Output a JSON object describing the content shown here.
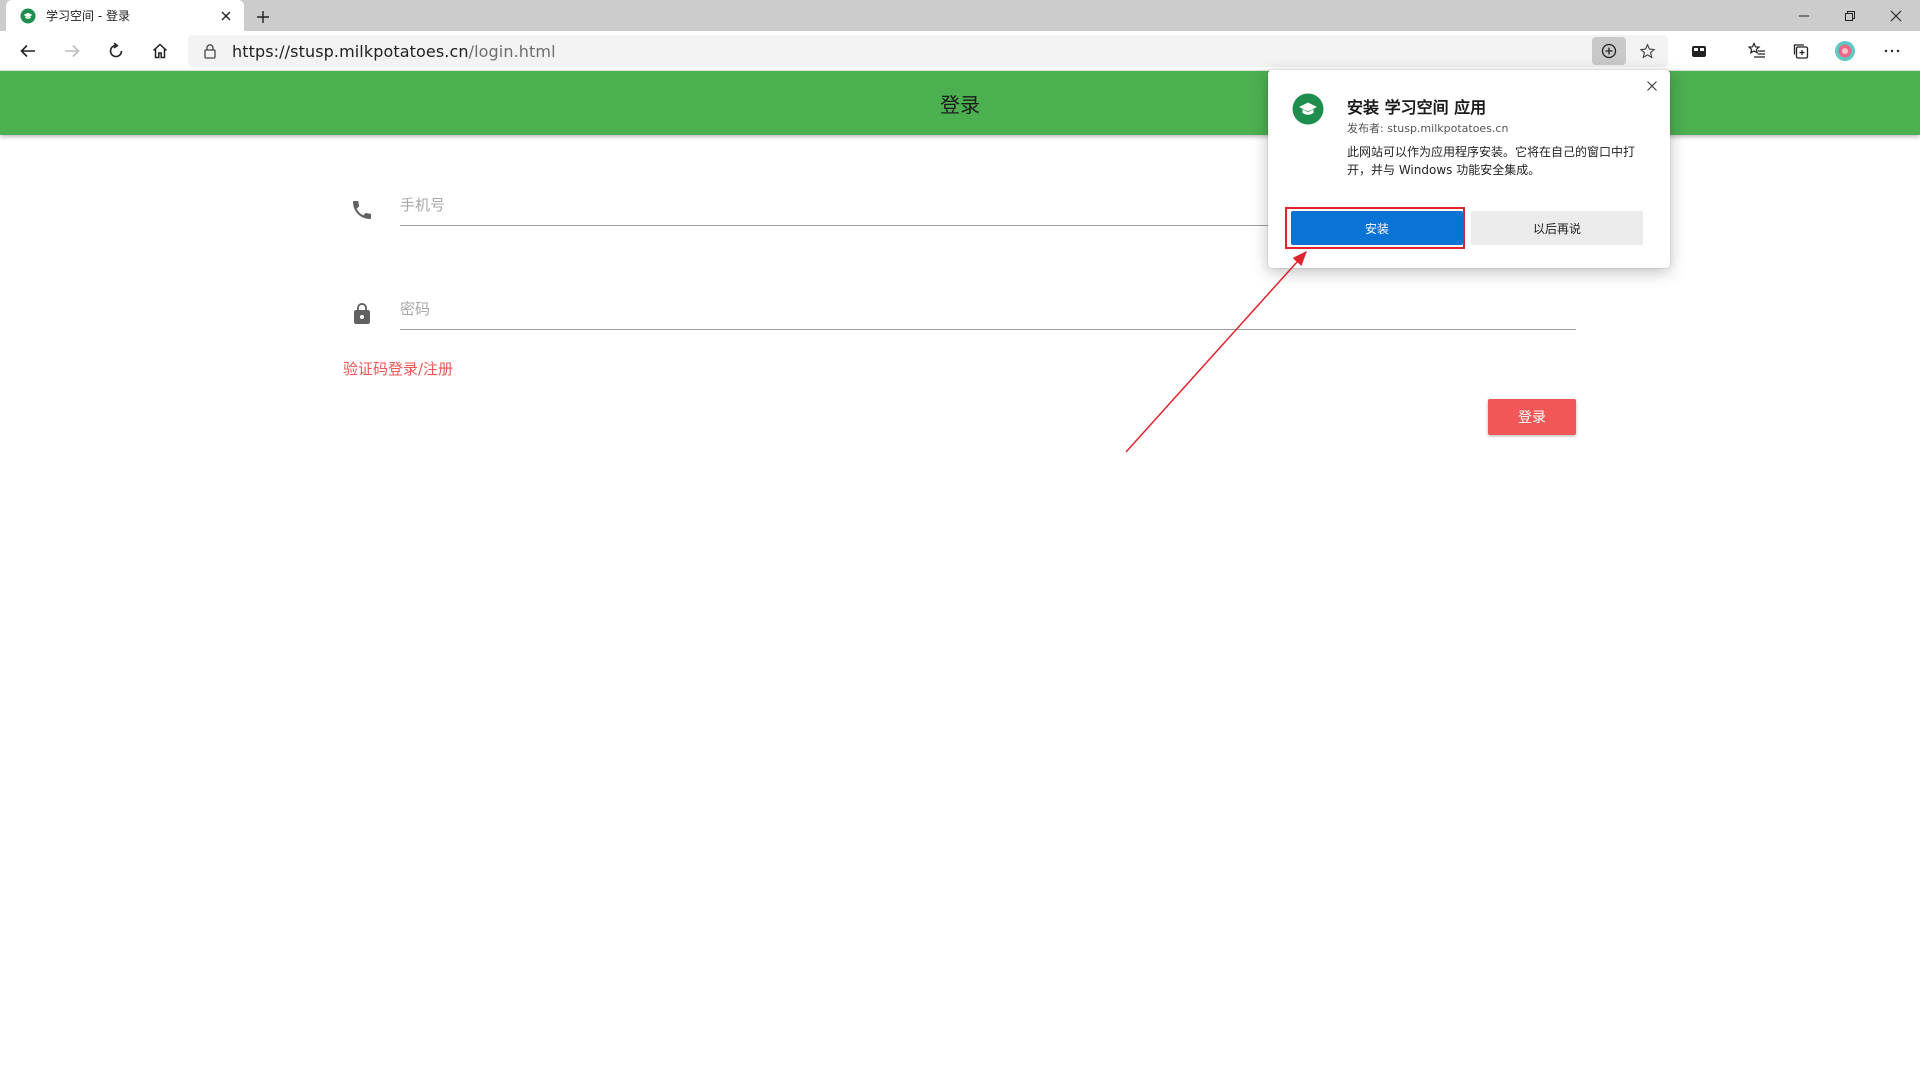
{
  "browser": {
    "tab_title": "学习空间 - 登录",
    "url_host": "https://stusp.milkpotatoes.cn",
    "url_path": "/login.html"
  },
  "page": {
    "header_title": "登录",
    "phone_placeholder": "手机号",
    "password_placeholder": "密码",
    "sms_login_link": "验证码登录/注册",
    "login_button": "登录"
  },
  "install_popup": {
    "title": "安装 学习空间 应用",
    "publisher": "发布者: stusp.milkpotatoes.cn",
    "description": "此网站可以作为应用程序安装。它将在自己的窗口中打开，并与 Windows 功能安全集成。",
    "install_button": "安装",
    "later_button": "以后再说"
  },
  "colors": {
    "header_green": "#4caf50",
    "accent_red": "#f25757",
    "install_blue": "#0a74d6",
    "annotation_red": "#e0242e"
  },
  "icons": [
    "favicon-icon",
    "close-icon",
    "plus-icon",
    "minimize-icon",
    "restore-icon",
    "back-icon",
    "forward-icon",
    "refresh-icon",
    "home-icon",
    "lock-icon",
    "app-install-icon",
    "star-icon",
    "reading-view-icon",
    "favorites-icon",
    "collections-icon",
    "profile-icon",
    "more-icon",
    "phone-icon",
    "password-lock-icon",
    "graduation-cap-icon"
  ]
}
